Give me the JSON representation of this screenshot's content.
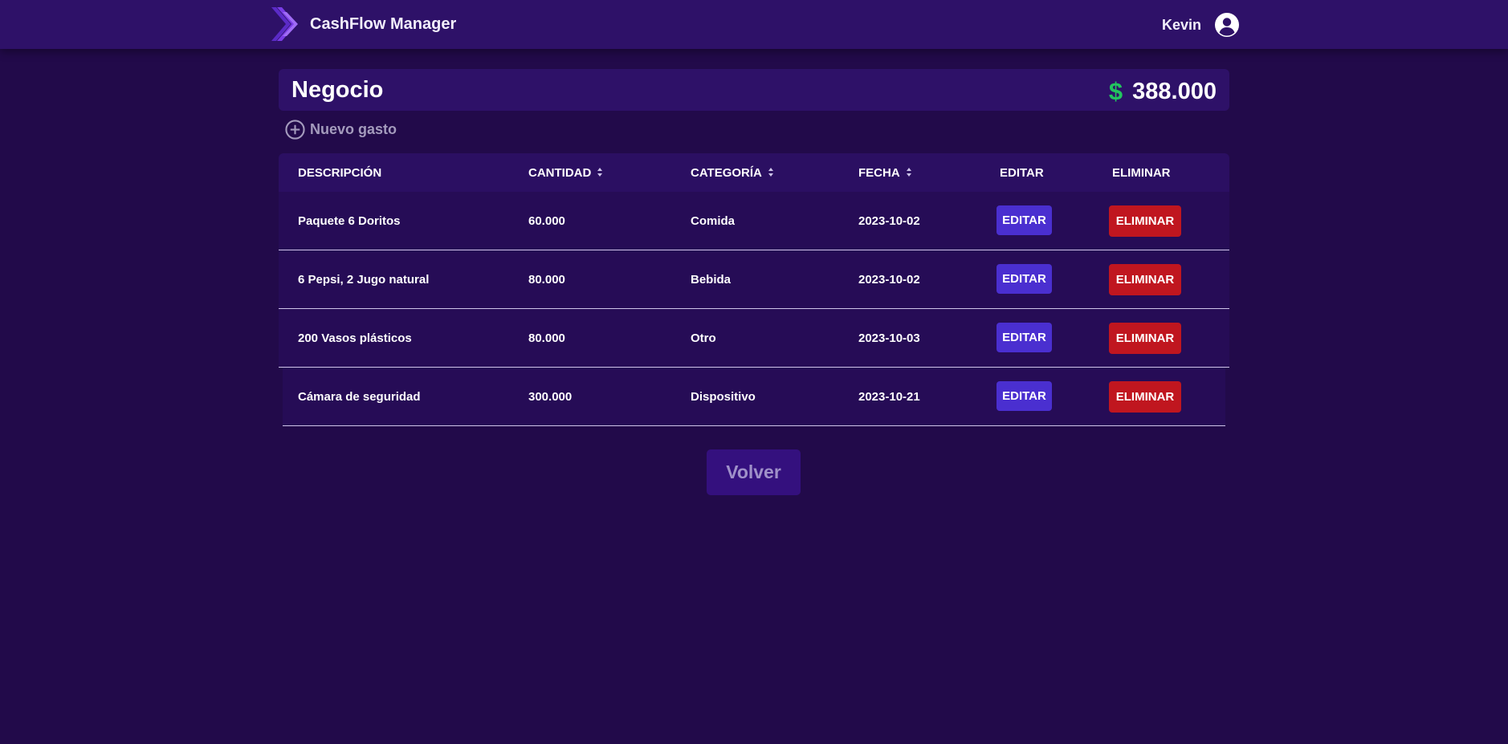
{
  "navbar": {
    "logo_icon": "chevron-stack-logo-icon",
    "app_title": "CashFlow Manager",
    "user_name": "Kevin",
    "avatar_icon": "user-circle-icon"
  },
  "budget": {
    "title": "Negocio",
    "currency_symbol": "$",
    "total": "388.000"
  },
  "new_expense": {
    "icon": "plus-circle-icon",
    "label": "Nuevo gasto"
  },
  "table": {
    "headers": {
      "description": "DESCRIPCIÓN",
      "amount": "CANTIDAD",
      "category": "CATEGORÍA",
      "date": "FECHA",
      "edit": "EDITAR",
      "delete": "ELIMINAR"
    },
    "rows": [
      {
        "description": "Paquete 6 Doritos",
        "amount": "60.000",
        "category": "Comida",
        "date": "2023-10-02",
        "edit": "EDITAR",
        "delete": "ELIMINAR"
      },
      {
        "description": "6 Pepsi, 2 Jugo natural",
        "amount": "80.000",
        "category": "Bebida",
        "date": "2023-10-02",
        "edit": "EDITAR",
        "delete": "ELIMINAR"
      },
      {
        "description": "200 Vasos plásticos",
        "amount": "80.000",
        "category": "Otro",
        "date": "2023-10-03",
        "edit": "EDITAR",
        "delete": "ELIMINAR"
      },
      {
        "description": "Cámara de seguridad",
        "amount": "300.000",
        "category": "Dispositivo",
        "date": "2023-10-21",
        "edit": "EDITAR",
        "delete": "ELIMINAR"
      }
    ]
  },
  "back_button": "Volver",
  "colors": {
    "background": "#220a4a",
    "navbar": "#2e1168",
    "edit_button": "#4a2fd0",
    "delete_button": "#c0161f",
    "money_green": "#22c55e"
  }
}
